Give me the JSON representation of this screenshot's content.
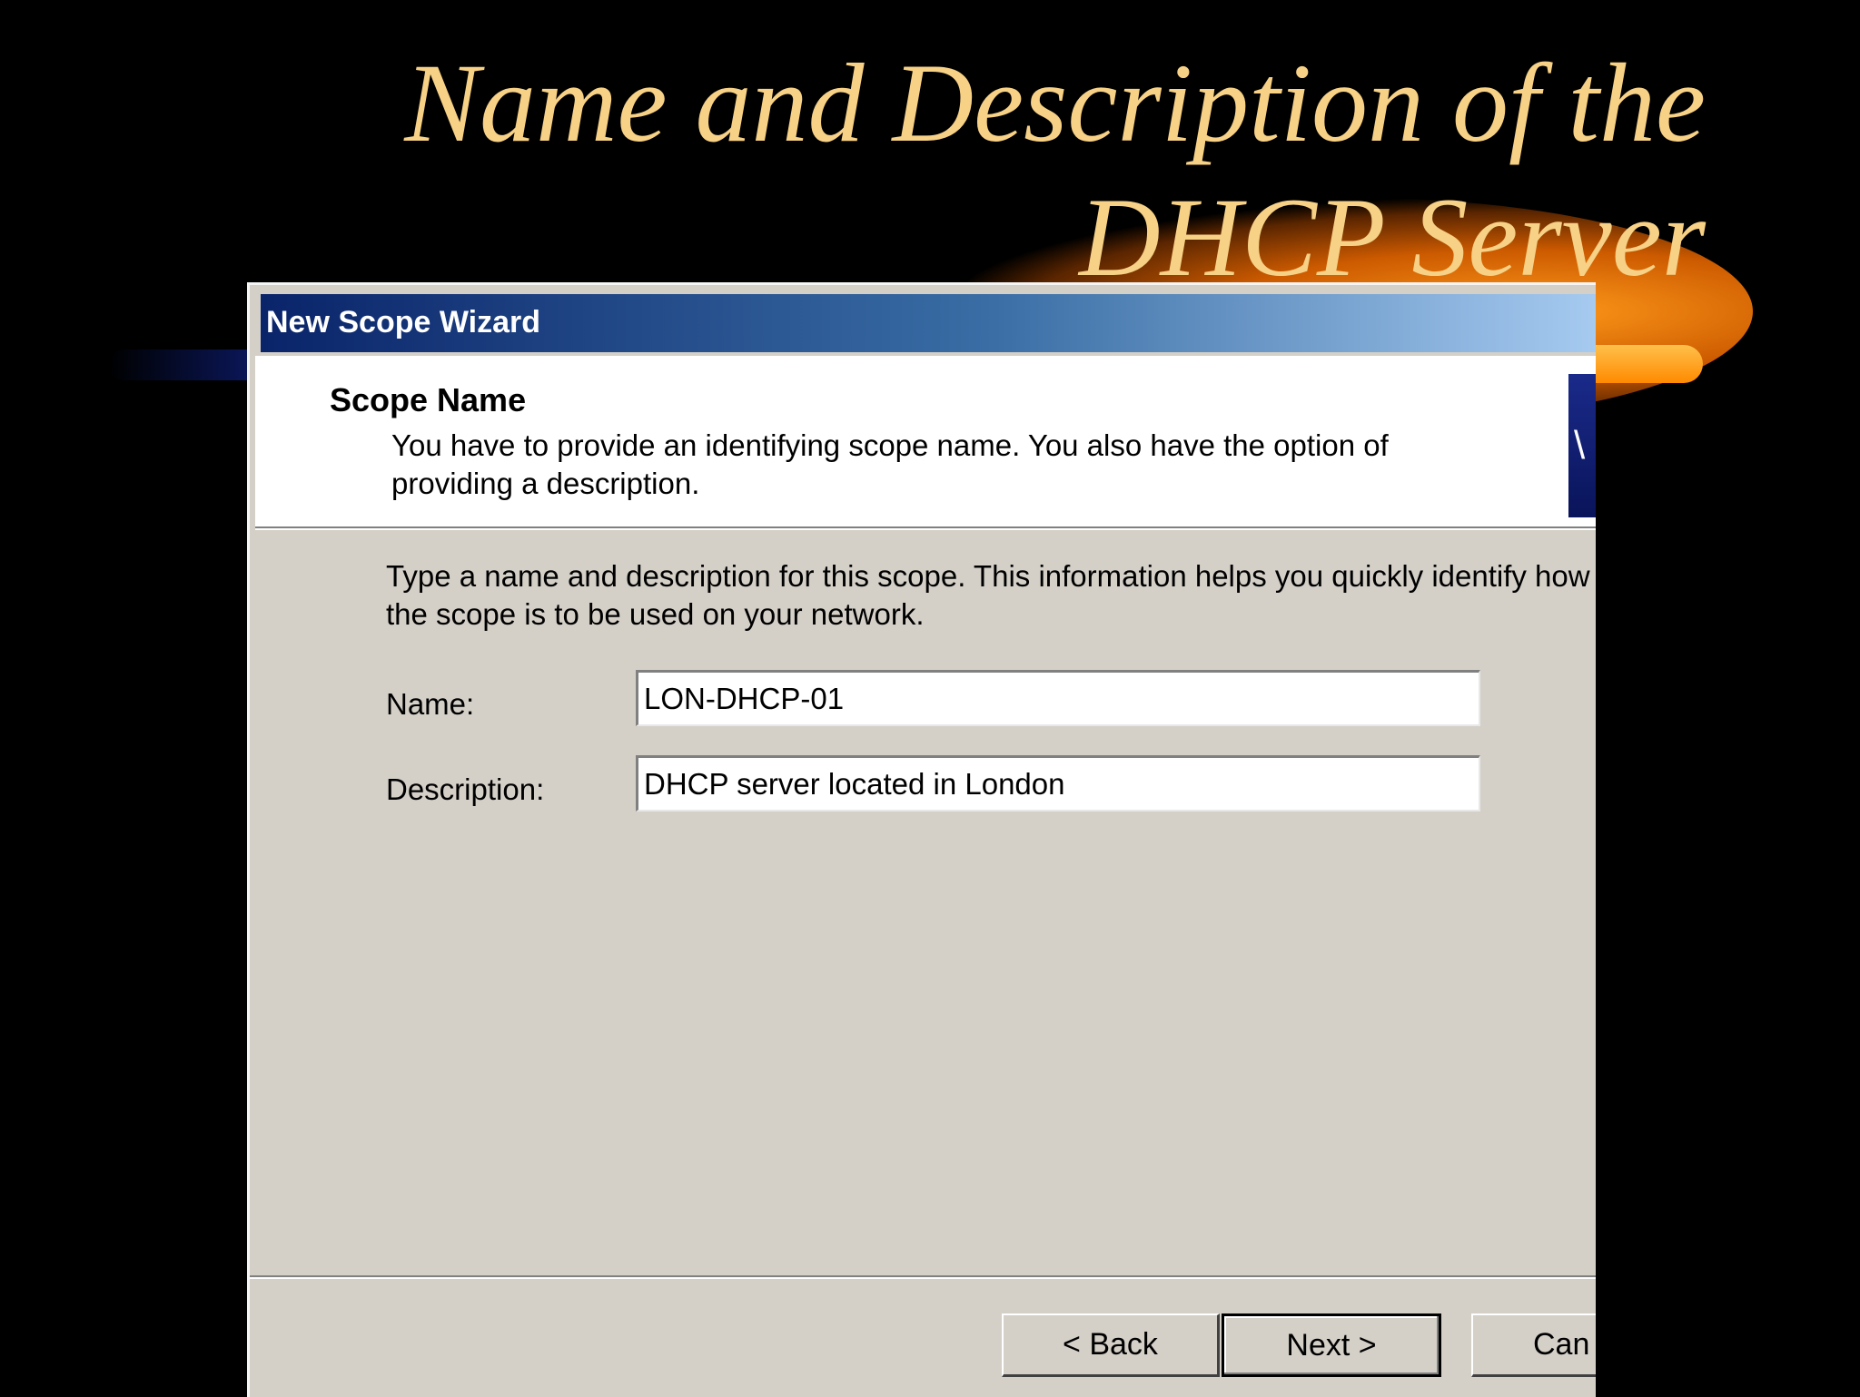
{
  "slide": {
    "title_line1": "Name and Description of the",
    "title_line2": "DHCP Server",
    "title_color": "#f7d186",
    "background": "#000000"
  },
  "dialog": {
    "window_title": "New Scope Wizard",
    "header_title": "Scope Name",
    "header_subtitle": "You have to provide an identifying scope name. You also have the option of providing a description.",
    "intro_text": "Type a name and description for this scope. This information helps you quickly identify how the scope is to be used on your network.",
    "name_label": "Name:",
    "name_value": "LON-DHCP-01",
    "description_label": "Description:",
    "description_value": "DHCP server located in London",
    "back_button": "< Back",
    "next_button": "Next >",
    "cancel_button": "Can"
  }
}
